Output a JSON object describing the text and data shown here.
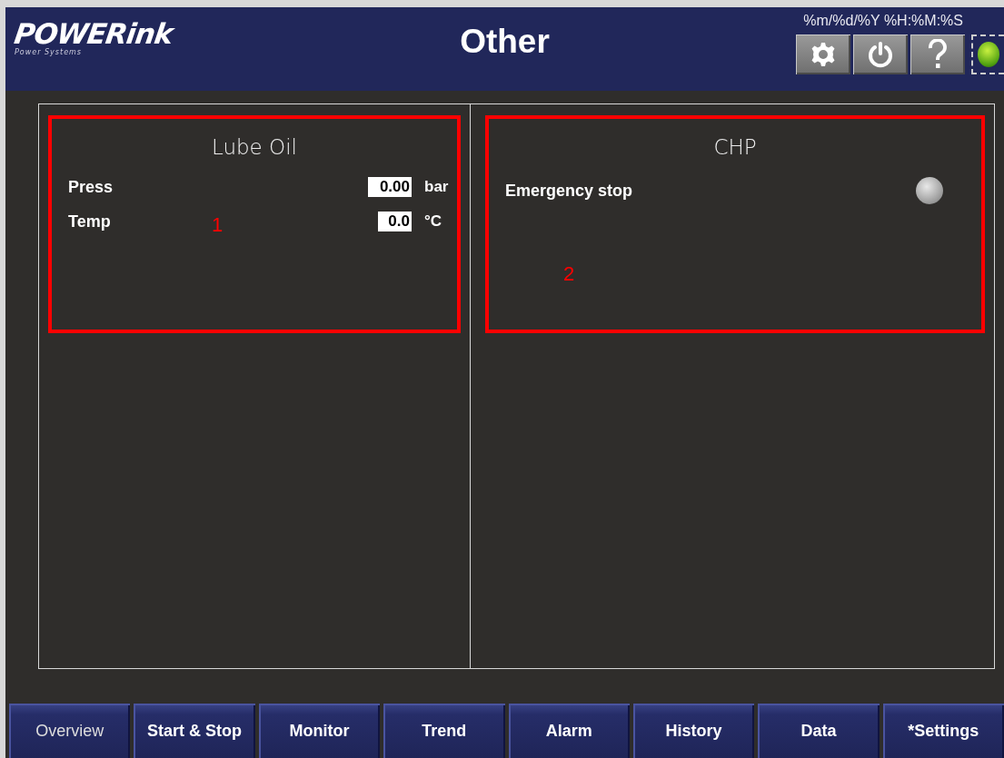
{
  "header": {
    "logo": "POWERink",
    "logo_tagline": "Power Systems",
    "title": "Other",
    "datetime": "%m/%d/%Y %H:%M:%S",
    "buttons": [
      {
        "kind": "settings"
      },
      {
        "kind": "power"
      },
      {
        "kind": "help"
      }
    ],
    "status_lamp": {
      "on": true
    }
  },
  "panels": [
    {
      "title": "Lube Oil",
      "annotation": "1",
      "rows": [
        {
          "kind": "value",
          "label": "Press",
          "value": "0.00",
          "unit": "bar"
        },
        {
          "kind": "value",
          "label": "Temp",
          "value": "0.0",
          "unit": "°C"
        }
      ]
    },
    {
      "title": "CHP",
      "annotation": "2",
      "rows": [
        {
          "kind": "lamp",
          "label": "Emergency stop",
          "on": false
        }
      ]
    }
  ],
  "tabs": [
    {
      "label": "Overview",
      "selected": true
    },
    {
      "label": "Start & Stop",
      "selected": false
    },
    {
      "label": "Monitor",
      "selected": false
    },
    {
      "label": "Trend",
      "selected": false
    },
    {
      "label": "Alarm",
      "selected": false
    },
    {
      "label": "History",
      "selected": false
    },
    {
      "label": "Data",
      "selected": false
    },
    {
      "label": "*Settings",
      "selected": false
    }
  ]
}
